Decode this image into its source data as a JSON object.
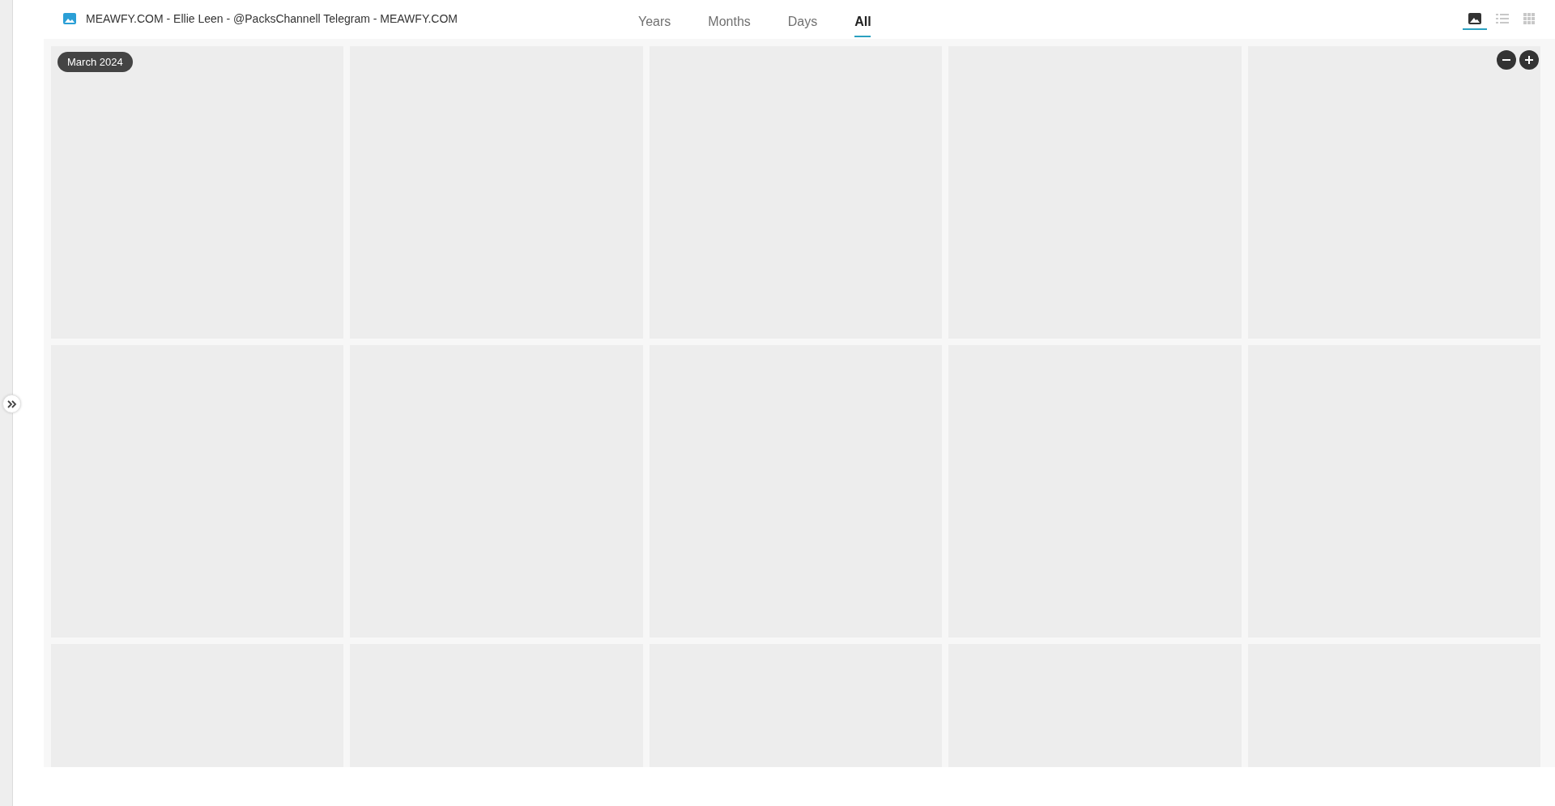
{
  "header": {
    "title": "MEAWFY.COM - Ellie Leen - @PacksChannell Telegram - MEAWFY.COM"
  },
  "tabs": [
    {
      "label": "Years",
      "selected": false
    },
    {
      "label": "Months",
      "selected": false
    },
    {
      "label": "Days",
      "selected": false
    },
    {
      "label": "All",
      "selected": true
    }
  ],
  "view_modes": [
    {
      "kind": "photo",
      "selected": true
    },
    {
      "kind": "list",
      "selected": false
    },
    {
      "kind": "grid",
      "selected": false
    }
  ],
  "gallery": {
    "date_label": "March 2024",
    "tiles": [
      {
        "kind": "placeholder"
      },
      {
        "kind": "placeholder"
      },
      {
        "kind": "placeholder"
      },
      {
        "kind": "placeholder"
      },
      {
        "kind": "placeholder"
      },
      {
        "kind": "placeholder"
      },
      {
        "kind": "placeholder"
      },
      {
        "kind": "placeholder"
      },
      {
        "kind": "placeholder"
      },
      {
        "kind": "placeholder"
      },
      {
        "kind": "placeholder"
      },
      {
        "kind": "placeholder"
      },
      {
        "kind": "placeholder"
      },
      {
        "kind": "placeholder"
      },
      {
        "kind": "placeholder"
      }
    ]
  }
}
